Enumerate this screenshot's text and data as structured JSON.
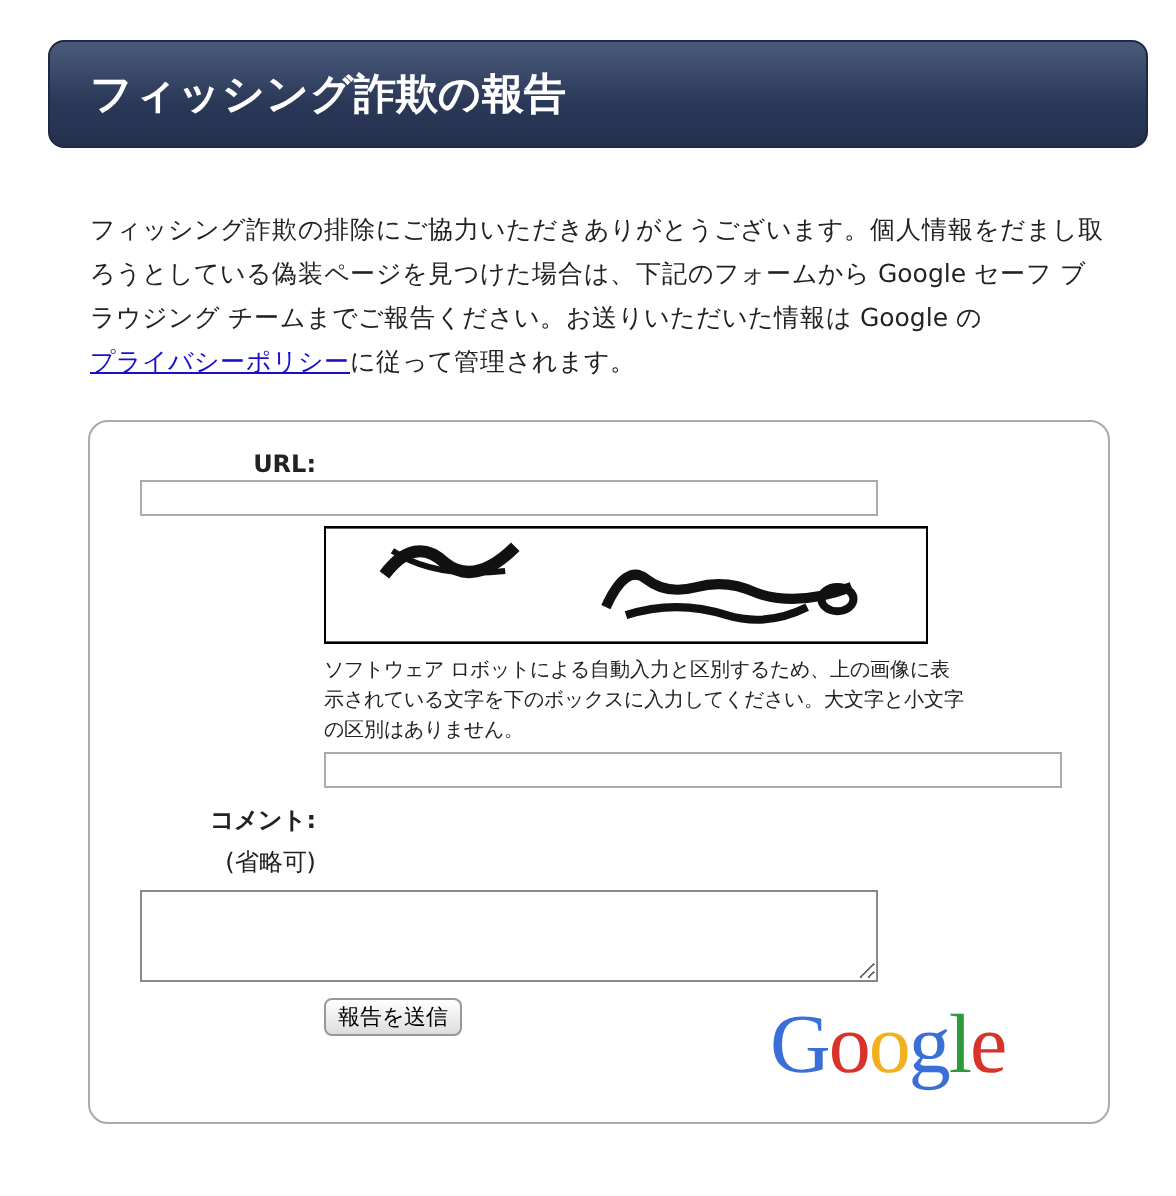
{
  "header": {
    "title": "フィッシング詐欺の報告"
  },
  "intro": {
    "before": "フィッシング詐欺の排除にご協力いただきありがとうございます。個人情報をだまし取ろうとしている偽装ページを見つけた場合は、下記のフォームから Google セーフ ブラウジング チームまでご報告ください。お送りいただいた情報は Google の",
    "link": "プライバシーポリシー",
    "after": "に従って管理されます。"
  },
  "form": {
    "url_label": "URL:",
    "captcha_help": "ソフトウェア ロボットによる自動入力と区別するため、上の画像に表示されている文字を下のボックスに入力してください。大文字と小文字の区別はありません。",
    "comment_label": "コメント:",
    "comment_optional": "(省略可)",
    "submit": "報告を送信",
    "logo": "Google"
  }
}
